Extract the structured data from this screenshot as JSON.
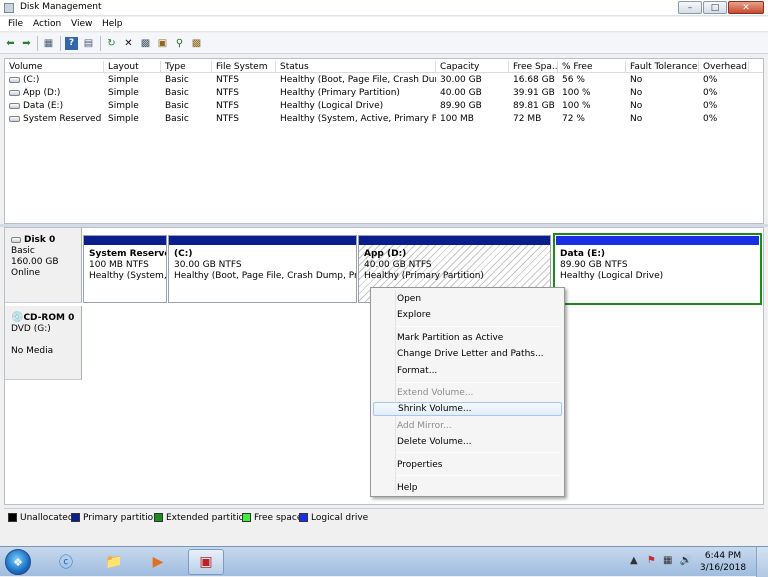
{
  "window": {
    "title": "Disk Management"
  },
  "menu": {
    "items": [
      "File",
      "Action",
      "View",
      "Help"
    ]
  },
  "toolbar_icons": [
    "back-arrow-icon",
    "forward-arrow-icon",
    "console-tree-icon",
    "help-icon",
    "properties-icon",
    "refresh-icon",
    "delete-icon",
    "properties2-icon",
    "open-icon",
    "search-icon",
    "extra-icon"
  ],
  "volume_list": {
    "columns": [
      "Volume",
      "Layout",
      "Type",
      "File System",
      "Status",
      "Capacity",
      "Free Spa...",
      "% Free",
      "Fault Tolerance",
      "Overhead"
    ],
    "rows": [
      {
        "volume": "(C:)",
        "layout": "Simple",
        "type": "Basic",
        "fs": "NTFS",
        "status": "Healthy (Boot, Page File, Crash Dum...",
        "capacity": "30.00 GB",
        "free": "16.68 GB",
        "pct": "56 %",
        "fault": "No",
        "overhead": "0%"
      },
      {
        "volume": "App (D:)",
        "layout": "Simple",
        "type": "Basic",
        "fs": "NTFS",
        "status": "Healthy (Primary Partition)",
        "capacity": "40.00 GB",
        "free": "39.91 GB",
        "pct": "100 %",
        "fault": "No",
        "overhead": "0%"
      },
      {
        "volume": "Data (E:)",
        "layout": "Simple",
        "type": "Basic",
        "fs": "NTFS",
        "status": "Healthy (Logical Drive)",
        "capacity": "89.90 GB",
        "free": "89.81 GB",
        "pct": "100 %",
        "fault": "No",
        "overhead": "0%"
      },
      {
        "volume": "System Reserved",
        "layout": "Simple",
        "type": "Basic",
        "fs": "NTFS",
        "status": "Healthy (System, Active, Primary Par...",
        "capacity": "100 MB",
        "free": "72 MB",
        "pct": "72 %",
        "fault": "No",
        "overhead": "0%"
      }
    ]
  },
  "disk0": {
    "name": "Disk 0",
    "type": "Basic",
    "size": "160.00 GB",
    "state": "Online",
    "partitions": [
      {
        "name": "System Reserved",
        "size": "100 MB NTFS",
        "status": "Healthy (System, A",
        "color": "#0a1e8c"
      },
      {
        "name": "(C:)",
        "size": "30.00 GB NTFS",
        "status": "Healthy (Boot, Page File, Crash Dump, Primar",
        "color": "#0a1e8c"
      },
      {
        "name": "App  (D:)",
        "size": "40.00 GB NTFS",
        "status": "Healthy (Primary Partition)",
        "color": "#0a1e8c"
      },
      {
        "name": "Data  (E:)",
        "size": "89.90 GB NTFS",
        "status": "Healthy (Logical Drive)",
        "color": "#1a2ee6"
      }
    ]
  },
  "cdrom0": {
    "name": "CD-ROM 0",
    "drive": "DVD (G:)",
    "media": "No Media"
  },
  "legend": [
    {
      "label": "Unallocated",
      "color": "#000000"
    },
    {
      "label": "Primary partition",
      "color": "#0a1e8c"
    },
    {
      "label": "Extended partition",
      "color": "#1a8c1a"
    },
    {
      "label": "Free space",
      "color": "#3cf03c"
    },
    {
      "label": "Logical drive",
      "color": "#1a2ee6"
    }
  ],
  "context_menu": {
    "items": [
      {
        "label": "Open",
        "enabled": true
      },
      {
        "label": "Explore",
        "enabled": true
      },
      {
        "label": "Mark Partition as Active",
        "enabled": true
      },
      {
        "label": "Change Drive Letter and Paths...",
        "enabled": true
      },
      {
        "label": "Format...",
        "enabled": true
      },
      {
        "label": "Extend Volume...",
        "enabled": false
      },
      {
        "label": "Shrink Volume...",
        "enabled": true,
        "highlighted": true
      },
      {
        "label": "Add Mirror...",
        "enabled": false
      },
      {
        "label": "Delete Volume...",
        "enabled": true
      },
      {
        "label": "Properties",
        "enabled": true
      },
      {
        "label": "Help",
        "enabled": true
      }
    ]
  },
  "taskbar": {
    "time": "6:44 PM",
    "date": "3/16/2018"
  }
}
